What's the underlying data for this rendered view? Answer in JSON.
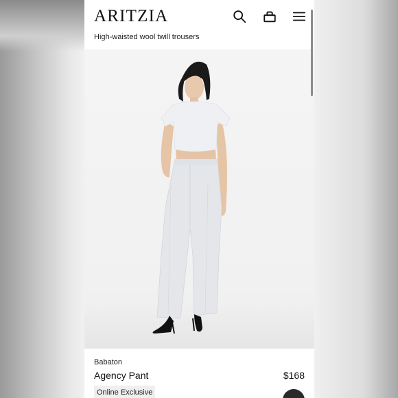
{
  "brand_logo": "ARITZIA",
  "header": {
    "subtitle": "High-waisted wool twill trousers"
  },
  "icons": {
    "search": "search-icon",
    "bag": "shopping-bag-icon",
    "menu": "hamburger-menu-icon"
  },
  "product": {
    "brand": "Babaton",
    "name": "Agency Pant",
    "price": "$168",
    "badge": "Online Exclusive"
  },
  "colors": {
    "text": "#111111",
    "badge_bg": "#efefef",
    "hero_bg": "#f2f2f2",
    "garment": "#e4e6ea",
    "shoes": "#111111"
  }
}
